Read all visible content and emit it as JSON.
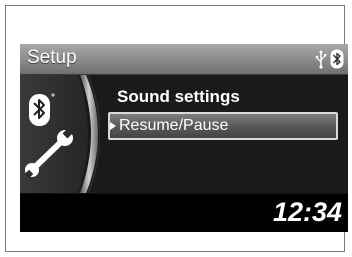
{
  "header": {
    "title": "Setup",
    "status_icons": [
      "usb-icon",
      "bluetooth-icon"
    ]
  },
  "sidebar": {
    "icons": [
      "bluetooth-icon",
      "wrench-icon"
    ]
  },
  "menu": {
    "heading": "Sound settings",
    "selected_item": "Resume/Pause"
  },
  "footer": {
    "clock": "12:34"
  },
  "colors": {
    "header_gradient_top": "#a8a8a8",
    "screen_bg": "#111111",
    "highlight_border": "#d9d9d9"
  }
}
